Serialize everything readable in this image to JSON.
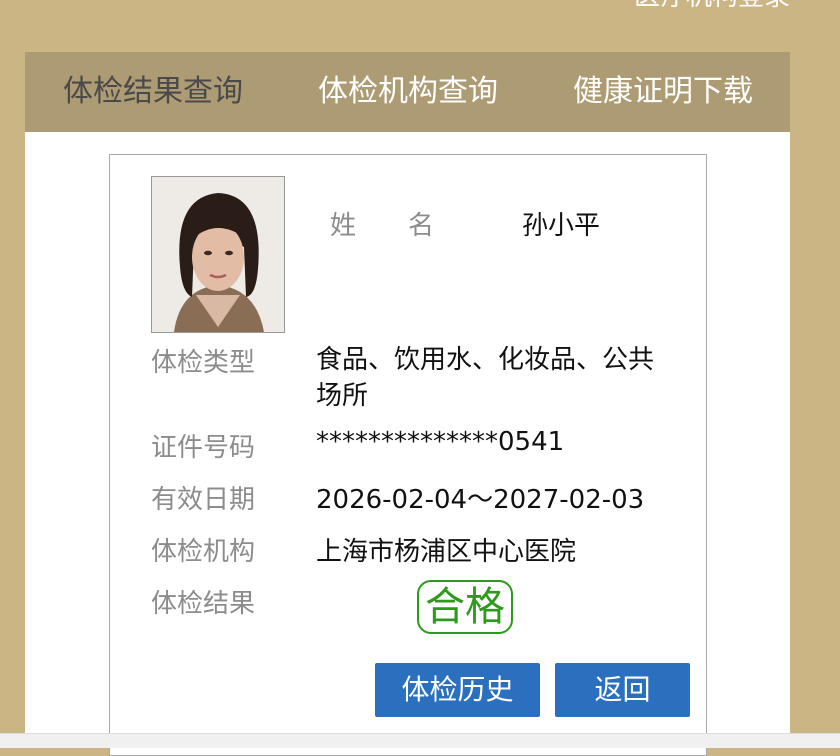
{
  "header": {
    "top_link": "医疗机构登录"
  },
  "nav": {
    "tabs": [
      {
        "label": "体检结果查询",
        "active": true
      },
      {
        "label": "体检机构查询",
        "active": false
      },
      {
        "label": "健康证明下载",
        "active": false
      }
    ]
  },
  "record": {
    "name_label": "姓　　名",
    "name": "孙小平",
    "type_label": "体检类型",
    "type": "食品、饮用水、化妆品、公共场所",
    "id_label": "证件号码",
    "id_number": "**************0541",
    "validity_label": "有效日期",
    "validity": "2026-02-04～2027-02-03",
    "institution_label": "体检机构",
    "institution": "上海市杨浦区中心医院",
    "result_label": "体检结果",
    "result": "合格"
  },
  "actions": {
    "history": "体检历史",
    "back": "返回"
  },
  "colors": {
    "background": "#cbb585",
    "nav": "#ad9b73",
    "button": "#2b70bf",
    "pass": "#2e9a1c"
  }
}
